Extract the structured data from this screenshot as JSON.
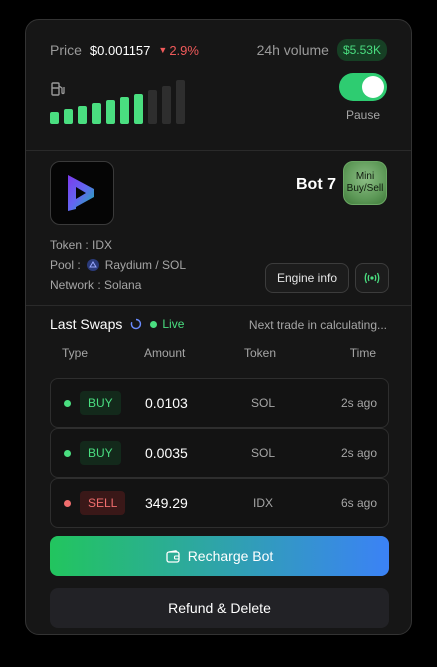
{
  "price": {
    "label": "Price",
    "value": "$0.001157",
    "change": "2.9%",
    "change_direction": "down",
    "change_color": "#f05a5a"
  },
  "volume": {
    "label": "24h volume",
    "value": "$5.53K",
    "color": "#4ade80"
  },
  "gas_bars": {
    "levels_filled": 7,
    "levels_total": 10,
    "active_color": "#4ade80",
    "inactive_color": "#2e2e2e"
  },
  "pause_toggle": {
    "label": "Pause",
    "on": true,
    "color": "#2ecc71"
  },
  "bot": {
    "name": "Bot 7",
    "badge": "Mini Buy/Sell"
  },
  "token_info": {
    "token": "Token : IDX",
    "pool": "Pool :",
    "pool_value": "Raydium / SOL",
    "network": "Network : Solana"
  },
  "buttons": {
    "engine_info": "Engine info",
    "recharge": "Recharge Bot",
    "refund": "Refund & Delete"
  },
  "swaps": {
    "title": "Last Swaps",
    "live": "Live",
    "status": "Next trade in calculating...",
    "columns": [
      "Type",
      "Amount",
      "Token",
      "Time"
    ],
    "rows": [
      {
        "type": "BUY",
        "amount": "0.0103",
        "token": "SOL",
        "time": "2s ago"
      },
      {
        "type": "BUY",
        "amount": "0.0035",
        "token": "SOL",
        "time": "2s ago"
      },
      {
        "type": "SELL",
        "amount": "349.29",
        "token": "IDX",
        "time": "6s ago"
      }
    ]
  },
  "icons": {
    "gas": "gas-pump-icon",
    "logo": "dexter-logo",
    "pool": "raydium-icon",
    "signal": "broadcast-icon",
    "wallet": "wallet-icon",
    "refresh": "refresh-icon"
  }
}
